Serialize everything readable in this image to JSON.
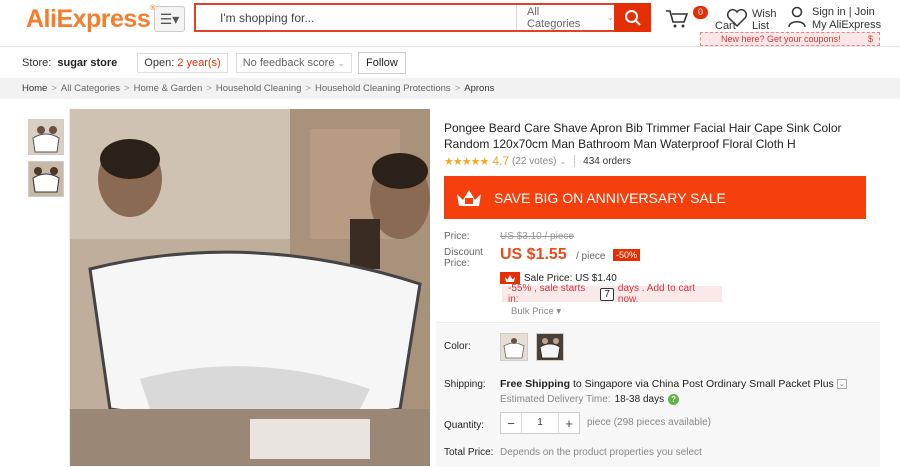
{
  "header": {
    "logo": "AliExpress",
    "logo_mark": "®",
    "search_placeholder": "I'm shopping for...",
    "category_select": "All Categories",
    "cart_count": "0",
    "cart_label": "Cart",
    "wish_label_1": "Wish",
    "wish_label_2": "List",
    "signin_1": "Sign in",
    "join": "Join",
    "signin_2": "My AliExpress",
    "coupon_text": "New here? Get your coupons!",
    "coupon_symbol": "$"
  },
  "store": {
    "label": "Store:",
    "name": "sugar store",
    "open_prefix": "Open:",
    "open_years": "2 year(s)",
    "feedback": "No feedback score",
    "follow": "Follow"
  },
  "breadcrumbs": [
    "Home",
    "All Categories",
    "Home & Garden",
    "Household Cleaning",
    "Household Cleaning Protections",
    "Aprons"
  ],
  "product": {
    "title": "Pongee Beard Care Shave Apron Bib Trimmer Facial Hair Cape Sink Color Random 120x70cm Man Bathroom Man Waterproof Floral Cloth H",
    "stars": "★★★★★",
    "rating": "4.7",
    "votes": "(22 votes)",
    "orders": "434 orders",
    "banner": "SAVE BIG ON ANNIVERSARY SALE",
    "price_label": "Price:",
    "original_price": "US $3.10 / piece",
    "discount_label_1": "Discount",
    "discount_label_2": "Price:",
    "price": "US $1.55",
    "per_piece": "/ piece",
    "percent_off": "-50%",
    "sale_price": "Sale Price: US $1.40",
    "countdown_prefix": "-55% , sale starts in:",
    "countdown_days": "7",
    "countdown_suffix": "days . Add to cart now.",
    "bulk_price": "Bulk Price",
    "color_label": "Color:",
    "shipping_label": "Shipping:",
    "shipping_bold": "Free Shipping",
    "shipping_rest": "to Singapore via China Post Ordinary Small Packet Plus",
    "eta_label": "Estimated Delivery Time:",
    "eta_days": "18-38 days",
    "quantity_label": "Quantity:",
    "quantity_value": "1",
    "pieces_available": "piece (298 pieces available)",
    "total_label": "Total Price:",
    "total_value": "Depends on the product properties you select"
  }
}
